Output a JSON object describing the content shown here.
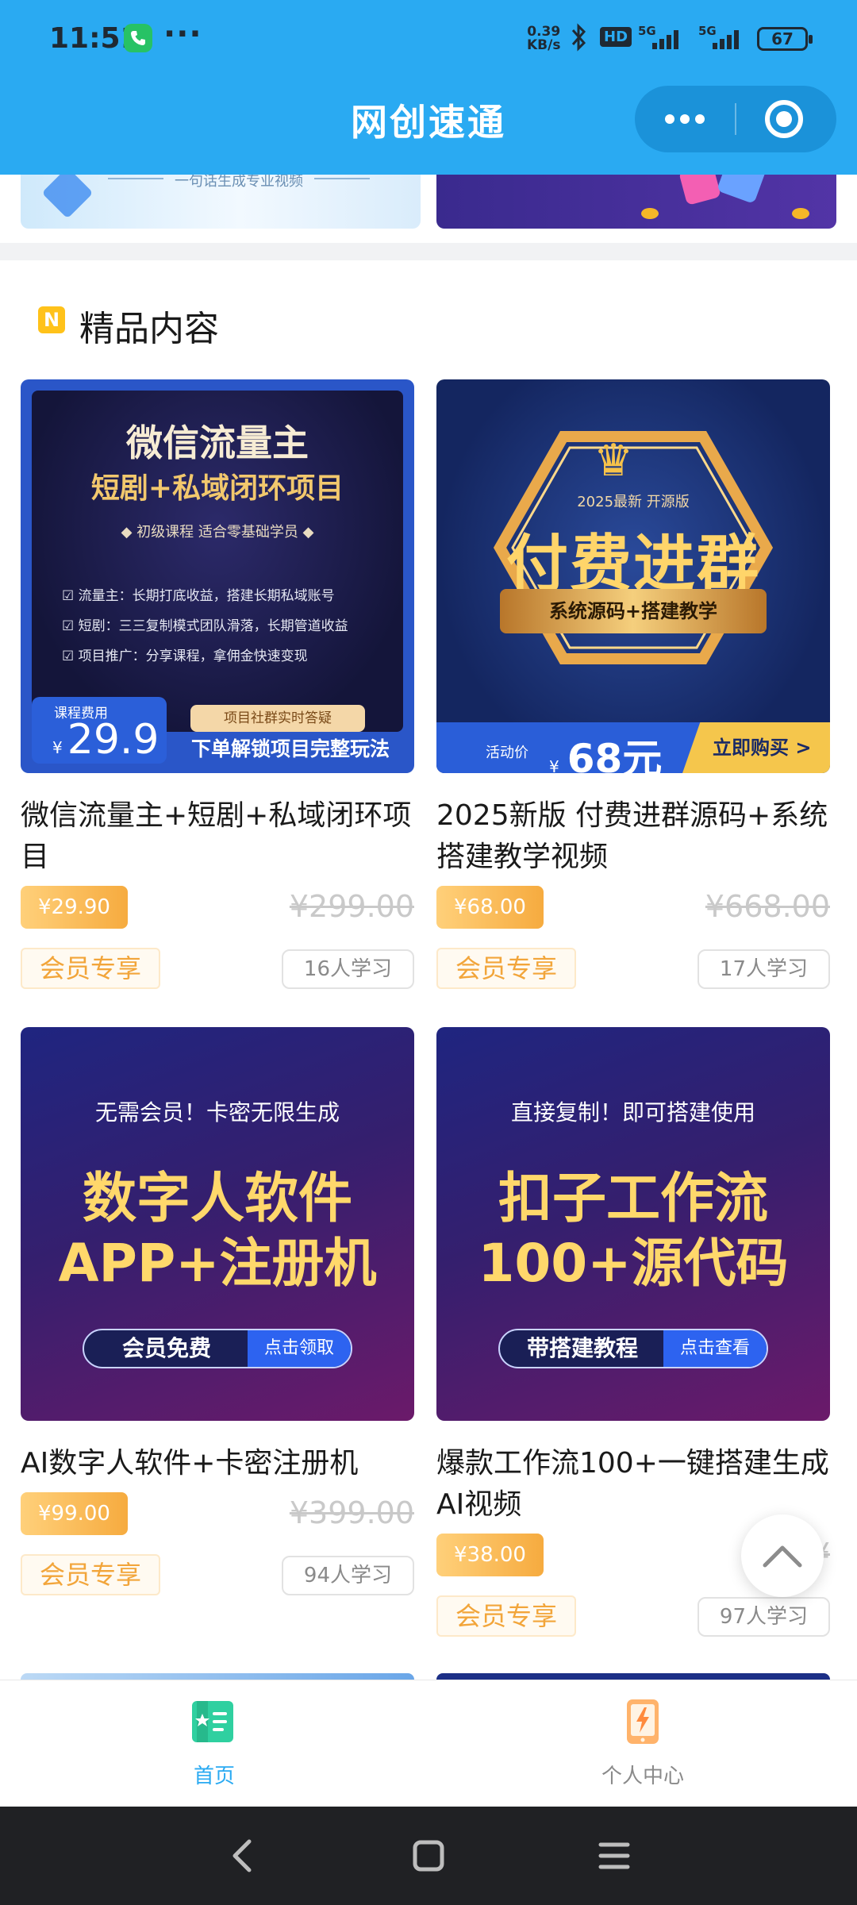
{
  "status_bar": {
    "time": "11:51",
    "speed_value": "0.39",
    "speed_unit": "KB/s",
    "hd": "HD",
    "net1": "5G",
    "net2": "5G",
    "battery": "67"
  },
  "header": {
    "title": "网创速通"
  },
  "banner": {
    "left_caption": "一句话生成专业视频"
  },
  "section": {
    "icon_letter": "N",
    "title": "精品内容"
  },
  "cards": [
    {
      "title": "微信流量主+短剧+私域闭环项目",
      "price": "¥29.90",
      "original_price": "¥299.00",
      "vip_tag": "会员专享",
      "learners": "16人学习",
      "thumb": {
        "line1": "微信流量主",
        "line2": "短剧+私域闭环项目",
        "line3": "◆  初级课程 适合零基础学员  ◆",
        "bullets": [
          "流量主：长期打底收益，搭建长期私域账号",
          "短剧：三三复制模式团队滑落，长期管道收益",
          "项目推广：分享课程，拿佣金快速变现"
        ],
        "fee_label": "课程费用",
        "fee_currency": "¥",
        "fee_value": "29.9",
        "qa": "项目社群实时答疑",
        "unlock": "下单解锁项目完整玩法"
      }
    },
    {
      "title": "2025新版 付费进群源码+系统搭建教学视频",
      "price": "¥68.00",
      "original_price": "¥668.00",
      "vip_tag": "会员专享",
      "learners": "17人学习",
      "thumb": {
        "version": "2025最新 开源版",
        "big": "付费进群",
        "ribbon": "系统源码+搭建教学",
        "act_label": "活动价",
        "act_currency": "¥",
        "act_value": "68元",
        "buy": "立即购买 >"
      }
    },
    {
      "title": "AI数字人软件+卡密注册机",
      "price": "¥99.00",
      "original_price": "¥399.00",
      "vip_tag": "会员专享",
      "learners": "94人学习",
      "thumb": {
        "sub": "无需会员！卡密无限生成",
        "l1": "数字人软件",
        "l2": "APP+注册机",
        "pill_a": "会员免费",
        "pill_b": "点击领取"
      }
    },
    {
      "title": "爆款工作流100+一键搭建生成AI视频",
      "price": "¥38.00",
      "original_price": "¥",
      "vip_tag": "会员专享",
      "learners": "97人学习",
      "thumb": {
        "sub": "直接复制！即可搭建使用",
        "l1": "扣子工作流",
        "l2": "100+源代码",
        "pill_a": "带搭建教程",
        "pill_b": "点击查看"
      }
    }
  ],
  "tabbar": {
    "items": [
      {
        "label": "首页",
        "icon": "home-book-icon",
        "active": true
      },
      {
        "label": "个人中心",
        "icon": "profile-tablet-icon",
        "active": false
      }
    ]
  },
  "colors": {
    "brand": "#2aaaf2",
    "price_gradient": [
      "#ffd07a",
      "#f6ab3f"
    ],
    "vip_text": "#f2a53a"
  }
}
